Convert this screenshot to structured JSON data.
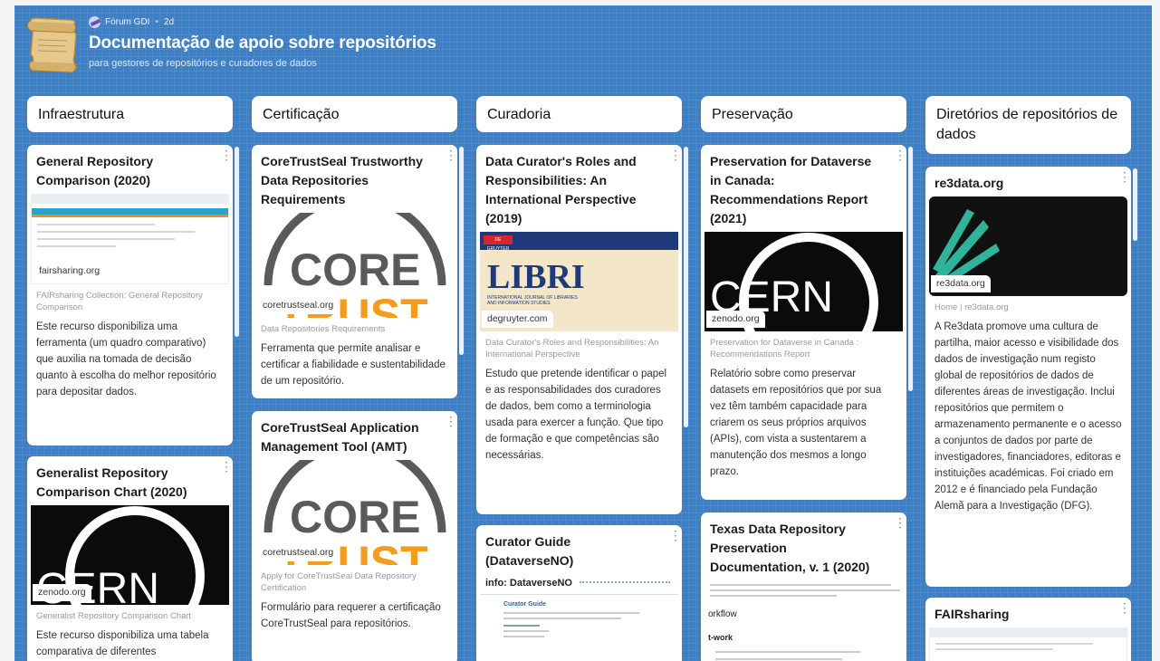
{
  "header": {
    "author": "Fórum GDI",
    "age": "2d",
    "title": "Documentação de apoio sobre repositórios",
    "subtitle": "para gestores de repositórios e curadores de dados"
  },
  "columns": [
    {
      "title": "Infraestrutura"
    },
    {
      "title": "Certificação"
    },
    {
      "title": "Curadoria"
    },
    {
      "title": "Preservação"
    },
    {
      "title": "Diretórios de repositórios de dados"
    }
  ],
  "cards": {
    "c1": {
      "title": "General Repository Comparison (2020)",
      "domain": "fairsharing.org",
      "link_title": "FAIRsharing Collection: General Repository Comparison",
      "desc": "Este recurso disponibiliza uma ferramenta (um quadro comparativo) que auxilia na tomada de decisão quanto à escolha do melhor repositório para depositar dados."
    },
    "c2": {
      "title": "Generalist Repository Comparison Chart (2020)",
      "domain": "zenodo.org",
      "link_title": "Generalist Repository Comparison Chart",
      "desc": "Este recurso disponibiliza uma tabela comparativa de diferentes"
    },
    "c3": {
      "title": "CoreTrustSeal Trustworthy Data Repositories Requirements",
      "domain": "coretrustseal.org",
      "link_title": "Data Repositories Requirements",
      "desc": "Ferramenta que permite analisar e certificar a fiabilidade e sustentabilidade de um repositório."
    },
    "c4": {
      "title": "CoreTrustSeal Application Management Tool (AMT)",
      "domain": "coretrustseal.org",
      "link_title": "Apply for CoreTrustSeal Data Repository Certification",
      "desc": "Formulário para requerer a certificação CoreTrustSeal para repositórios."
    },
    "c5": {
      "title": "Data Curator's Roles and Responsibilities: An International Perspective (2019)",
      "domain": "degruyter.com",
      "link_title": "Data Curator's Roles and Responsibilities: An International Perspective",
      "desc": "Estudo que pretende identificar o papel e as responsabilidades dos curadores de dados, bem como a terminologia usada para exercer a função. Que tipo de formação e que competências são necessárias."
    },
    "c6": {
      "title": "Curator Guide (DataverseNO)",
      "thumb_brand": "info: DataverseNO",
      "thumb_heading": "Curator Guide"
    },
    "c7": {
      "title": "Preservation for Dataverse in Canada: Recommendations Report (2021)",
      "domain": "zenodo.org",
      "link_title": "Preservation for Dataverse in Canada : Recommendations Report",
      "desc": "Relatório sobre como preservar datasets em repositórios que por sua vez têm também capacidade para criarem os seus próprios arquivos (APIs), com vista a sustentarem a manutenção dos mesmos a longo prazo."
    },
    "c8": {
      "title": "Texas Data Repository Preservation Documentation, v. 1 (2020)",
      "thumb_line1": "orkflow",
      "thumb_line2": "t-work"
    },
    "c9": {
      "title": "re3data.org",
      "domain": "re3data.org",
      "link_title": "Home | re3data.org",
      "desc": "A Re3data promove uma cultura de partilha, maior acesso e visibilidade dos dados de investigação num registo global de repositórios de dados de diferentes áreas de investigação. Inclui repositórios que permitem o armazenamento permanente e o acesso a conjuntos de dados por parte de investigadores, financiadores, editoras e instituições académicas. Foi criado em 2012 e é financiado pela Fundação Alemã para a Investigação (DFG)."
    },
    "c10": {
      "title": "FAIRsharing"
    }
  },
  "thumbs": {
    "cern_text": "CERN",
    "core_text": "CORE",
    "trust_text": "TRUST",
    "libri_text": "LIBRI",
    "libri_sub": "INTERNATIONAL JOURNAL OF LIBRARIES AND INFORMATION STUDIES",
    "libri_publisher": "DE GRUYTER"
  },
  "colors": {
    "board": "#3f7fc4",
    "core_gray": "#5a5a5a",
    "trust_orange": "#f39c1e",
    "libri_blue": "#1e3a7a",
    "libri_red": "#d9262b",
    "re3_teal": "#2fb39a"
  }
}
